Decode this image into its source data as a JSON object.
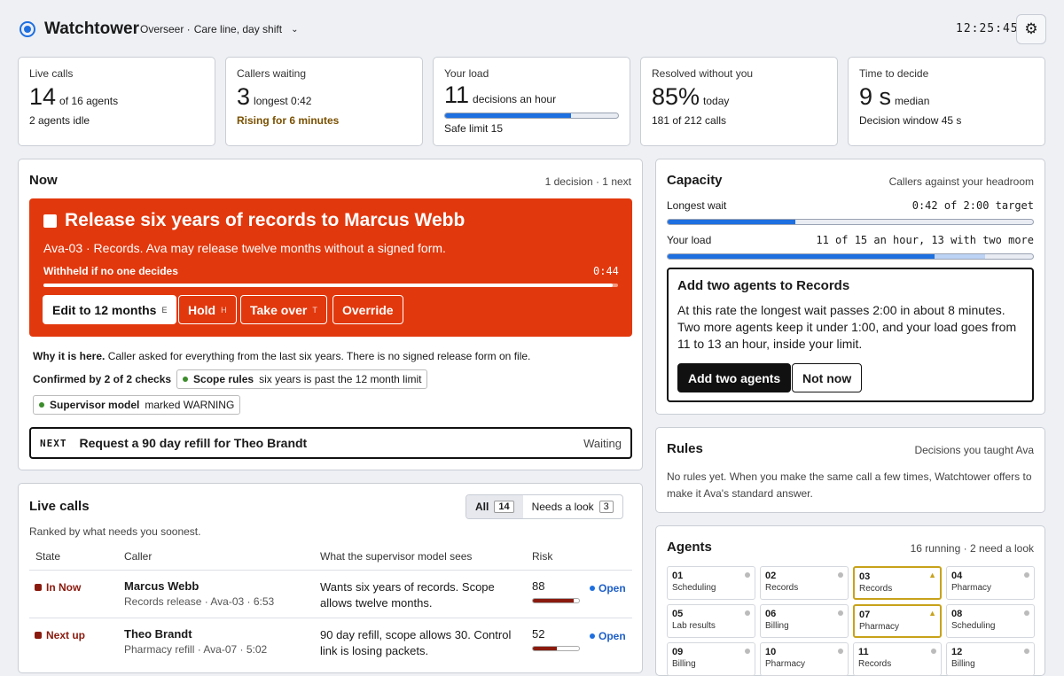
{
  "header": {
    "app_title": "Watchtower",
    "role_prefix": "Overseer ·",
    "role_value": "Care line, day shift",
    "clock": "12:25:45"
  },
  "stats": [
    {
      "label": "Live calls",
      "value": "14",
      "unit": "of 16 agents",
      "sub": "2 agents idle"
    },
    {
      "label": "Callers waiting",
      "value": "3",
      "unit": "longest 0:42",
      "sub": "Rising for 6 minutes"
    },
    {
      "label": "Your load",
      "value": "11",
      "unit": "decisions an hour",
      "sub": "Safe limit 15",
      "bar_fraction": 0.73
    },
    {
      "label": "Resolved without you",
      "value": "85%",
      "unit": "today",
      "sub": "181 of 212 calls"
    },
    {
      "label": "Time to decide",
      "value": "9 s",
      "unit": "median",
      "sub": "Decision window 45 s"
    }
  ],
  "now": {
    "title": "Now",
    "meta": "1 decision · 1 next",
    "alert": {
      "headline": "Release six years of records to Marcus Webb",
      "desc": "Ava-03 · Records. Ava may release twelve months without a signed form.",
      "withheld": "Withheld if no one decides",
      "timer": "0:44",
      "progress": 0.99,
      "buttons": [
        {
          "label": "Edit to 12 months",
          "key": "E"
        },
        {
          "label": "Hold",
          "key": "H"
        },
        {
          "label": "Take over",
          "key": "T"
        },
        {
          "label": "Override",
          "key": ""
        }
      ]
    },
    "why_label": "Why it is here.",
    "why_text": "Caller asked for everything from the last six years. There is no signed release form on file.",
    "confirmed": "Confirmed by 2 of 2 checks",
    "checks": [
      {
        "name": "Scope rules",
        "text": "six years is past the 12 month limit"
      },
      {
        "name": "Supervisor model",
        "text": "marked WARNING"
      }
    ],
    "next": {
      "tag": "NEXT",
      "text": "Request a 90 day refill for Theo Brandt",
      "status": "Waiting"
    }
  },
  "live": {
    "title": "Live calls",
    "subtitle": "Ranked by what needs you soonest.",
    "filters": [
      {
        "label": "All",
        "count": "14"
      },
      {
        "label": "Needs a look",
        "count": "3"
      }
    ],
    "columns": [
      "State",
      "Caller",
      "What the supervisor model sees",
      "Risk"
    ],
    "rows": [
      {
        "state": "In Now",
        "name": "Marcus Webb",
        "detail": "Records release · Ava-03 · 6:53",
        "sees": "Wants six years of records. Scope allows twelve months.",
        "risk": "88",
        "risk_fraction": 0.88,
        "status": "Open"
      },
      {
        "state": "Next up",
        "name": "Theo Brandt",
        "detail": "Pharmacy refill · Ava-07 · 5:02",
        "sees": "90 day refill, scope allows 30. Control link is losing packets.",
        "risk": "52",
        "risk_fraction": 0.52,
        "status": "Open"
      }
    ]
  },
  "capacity": {
    "title": "Capacity",
    "meta": "Callers against your headroom",
    "rows": [
      {
        "label": "Longest wait",
        "value": "0:42 of 2:00 target",
        "fraction": 0.35
      },
      {
        "label": "Your load",
        "value": "11 of 15 an hour, 13 with two more",
        "fraction": 0.73,
        "ghost": 0.87
      }
    ],
    "rec": {
      "title": "Add two agents to Records",
      "text": "At this rate the longest wait passes 2:00 in about 8 minutes. Two more agents keep it under 1:00, and your load goes from 11 to 13 an hour, inside your limit.",
      "primary": "Add two agents",
      "secondary": "Not now"
    }
  },
  "rules": {
    "title": "Rules",
    "meta": "Decisions you taught Ava",
    "text": "No rules yet. When you make the same call a few times, Watchtower offers to make it Ava's standard answer."
  },
  "agents": {
    "title": "Agents",
    "meta": "16 running · 2 need a look",
    "items": [
      {
        "id": "01",
        "role": "Scheduling",
        "warn": false
      },
      {
        "id": "02",
        "role": "Records",
        "warn": false
      },
      {
        "id": "03",
        "role": "Records",
        "warn": true
      },
      {
        "id": "04",
        "role": "Pharmacy",
        "warn": false
      },
      {
        "id": "05",
        "role": "Lab results",
        "warn": false
      },
      {
        "id": "06",
        "role": "Billing",
        "warn": false
      },
      {
        "id": "07",
        "role": "Pharmacy",
        "warn": true
      },
      {
        "id": "08",
        "role": "Scheduling",
        "warn": false
      },
      {
        "id": "09",
        "role": "Billing",
        "warn": false
      },
      {
        "id": "10",
        "role": "Pharmacy",
        "warn": false
      },
      {
        "id": "11",
        "role": "Records",
        "warn": false
      },
      {
        "id": "12",
        "role": "Billing",
        "warn": false
      }
    ]
  }
}
